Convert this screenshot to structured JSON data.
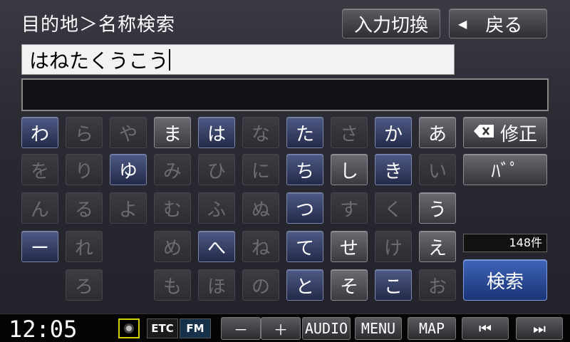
{
  "header": {
    "title": "目的地＞名称検索",
    "input_switch_label": "入力切換",
    "back_label": "戻る",
    "back_arrow": "◀"
  },
  "input": {
    "value": "はねたくうこう"
  },
  "keyboard": {
    "rows": [
      [
        {
          "label": "わ",
          "enabled": true,
          "tone": "blue"
        },
        {
          "label": "ら",
          "enabled": false,
          "tone": "gray"
        },
        {
          "label": "や",
          "enabled": false,
          "tone": "gray"
        },
        {
          "label": "ま",
          "enabled": true,
          "tone": "gray"
        },
        {
          "label": "は",
          "enabled": true,
          "tone": "blue"
        },
        {
          "label": "な",
          "enabled": false,
          "tone": "gray"
        },
        {
          "label": "た",
          "enabled": true,
          "tone": "blue"
        },
        {
          "label": "さ",
          "enabled": false,
          "tone": "gray"
        },
        {
          "label": "か",
          "enabled": true,
          "tone": "blue"
        },
        {
          "label": "あ",
          "enabled": true,
          "tone": "gray"
        }
      ],
      [
        {
          "label": "を",
          "enabled": false,
          "tone": "gray"
        },
        {
          "label": "り",
          "enabled": false,
          "tone": "gray"
        },
        {
          "label": "ゆ",
          "enabled": true,
          "tone": "blue"
        },
        {
          "label": "み",
          "enabled": false,
          "tone": "gray"
        },
        {
          "label": "ひ",
          "enabled": false,
          "tone": "gray"
        },
        {
          "label": "に",
          "enabled": false,
          "tone": "gray"
        },
        {
          "label": "ち",
          "enabled": true,
          "tone": "blue"
        },
        {
          "label": "し",
          "enabled": true,
          "tone": "gray"
        },
        {
          "label": "き",
          "enabled": true,
          "tone": "blue"
        },
        {
          "label": "い",
          "enabled": false,
          "tone": "gray"
        }
      ],
      [
        {
          "label": "ん",
          "enabled": false,
          "tone": "gray"
        },
        {
          "label": "る",
          "enabled": false,
          "tone": "gray"
        },
        {
          "label": "よ",
          "enabled": false,
          "tone": "gray"
        },
        {
          "label": "む",
          "enabled": false,
          "tone": "gray"
        },
        {
          "label": "ふ",
          "enabled": false,
          "tone": "gray"
        },
        {
          "label": "ぬ",
          "enabled": false,
          "tone": "gray"
        },
        {
          "label": "つ",
          "enabled": true,
          "tone": "blue"
        },
        {
          "label": "す",
          "enabled": false,
          "tone": "gray"
        },
        {
          "label": "く",
          "enabled": false,
          "tone": "gray"
        },
        {
          "label": "う",
          "enabled": true,
          "tone": "gray"
        }
      ],
      [
        {
          "label": "ー",
          "enabled": true,
          "tone": "blue"
        },
        {
          "label": "れ",
          "enabled": false,
          "tone": "gray"
        },
        null,
        {
          "label": "め",
          "enabled": false,
          "tone": "gray"
        },
        {
          "label": "へ",
          "enabled": true,
          "tone": "blue"
        },
        {
          "label": "ね",
          "enabled": false,
          "tone": "gray"
        },
        {
          "label": "て",
          "enabled": true,
          "tone": "blue"
        },
        {
          "label": "せ",
          "enabled": true,
          "tone": "gray"
        },
        {
          "label": "け",
          "enabled": false,
          "tone": "gray"
        },
        {
          "label": "え",
          "enabled": true,
          "tone": "gray"
        }
      ],
      [
        null,
        {
          "label": "ろ",
          "enabled": false,
          "tone": "gray"
        },
        null,
        {
          "label": "も",
          "enabled": false,
          "tone": "gray"
        },
        {
          "label": "ほ",
          "enabled": false,
          "tone": "gray"
        },
        {
          "label": "の",
          "enabled": false,
          "tone": "gray"
        },
        {
          "label": "と",
          "enabled": true,
          "tone": "blue"
        },
        {
          "label": "そ",
          "enabled": true,
          "tone": "gray"
        },
        {
          "label": "こ",
          "enabled": true,
          "tone": "blue"
        },
        {
          "label": "お",
          "enabled": false,
          "tone": "gray"
        }
      ]
    ]
  },
  "side": {
    "correct_label": "修正",
    "correct_icon": "backspace-icon",
    "dakuten_label": "ﾊﾞﾟ",
    "result_count": "148件",
    "search_label": "検索"
  },
  "statusbar": {
    "clock": "12:05",
    "etc_label": "ETC",
    "fm_label": "FM",
    "disc_icon": "disc-icon",
    "minus_label": "－",
    "plus_label": "＋",
    "audio_label": "AUDIO",
    "menu_label": "MENU",
    "map_label": "MAP",
    "prev_label": "⏮",
    "next_label": "⏭"
  },
  "colors": {
    "enabled_key_blue": "#3a4468",
    "enabled_key_gray": "#55555b",
    "search_button": "#2a4b9a",
    "disc_indicator_border": "#d5d100"
  }
}
